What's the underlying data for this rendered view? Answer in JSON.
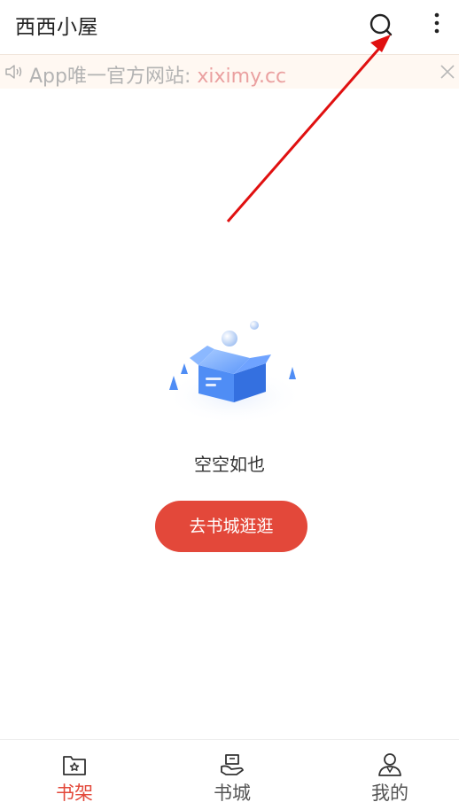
{
  "header": {
    "title": "西西小屋",
    "search_icon": "search-icon",
    "more_icon": "more-vertical-icon"
  },
  "notice": {
    "prefix": "App唯一官方网站: ",
    "link": "xiximy.cc",
    "speaker_icon": "speaker-icon",
    "close_icon": "close-icon"
  },
  "empty_state": {
    "illustration": "empty-box-icon",
    "message": "空空如也",
    "button_label": "去书城逛逛"
  },
  "bottom_nav": {
    "items": [
      {
        "label": "书架",
        "icon": "bookshelf-icon",
        "active": true
      },
      {
        "label": "书城",
        "icon": "bookstore-icon",
        "active": false
      },
      {
        "label": "我的",
        "icon": "profile-icon",
        "active": false
      }
    ]
  },
  "colors": {
    "accent": "#e3483a",
    "notice_bg": "#fff8f2",
    "annotation_arrow": "#e01010"
  }
}
